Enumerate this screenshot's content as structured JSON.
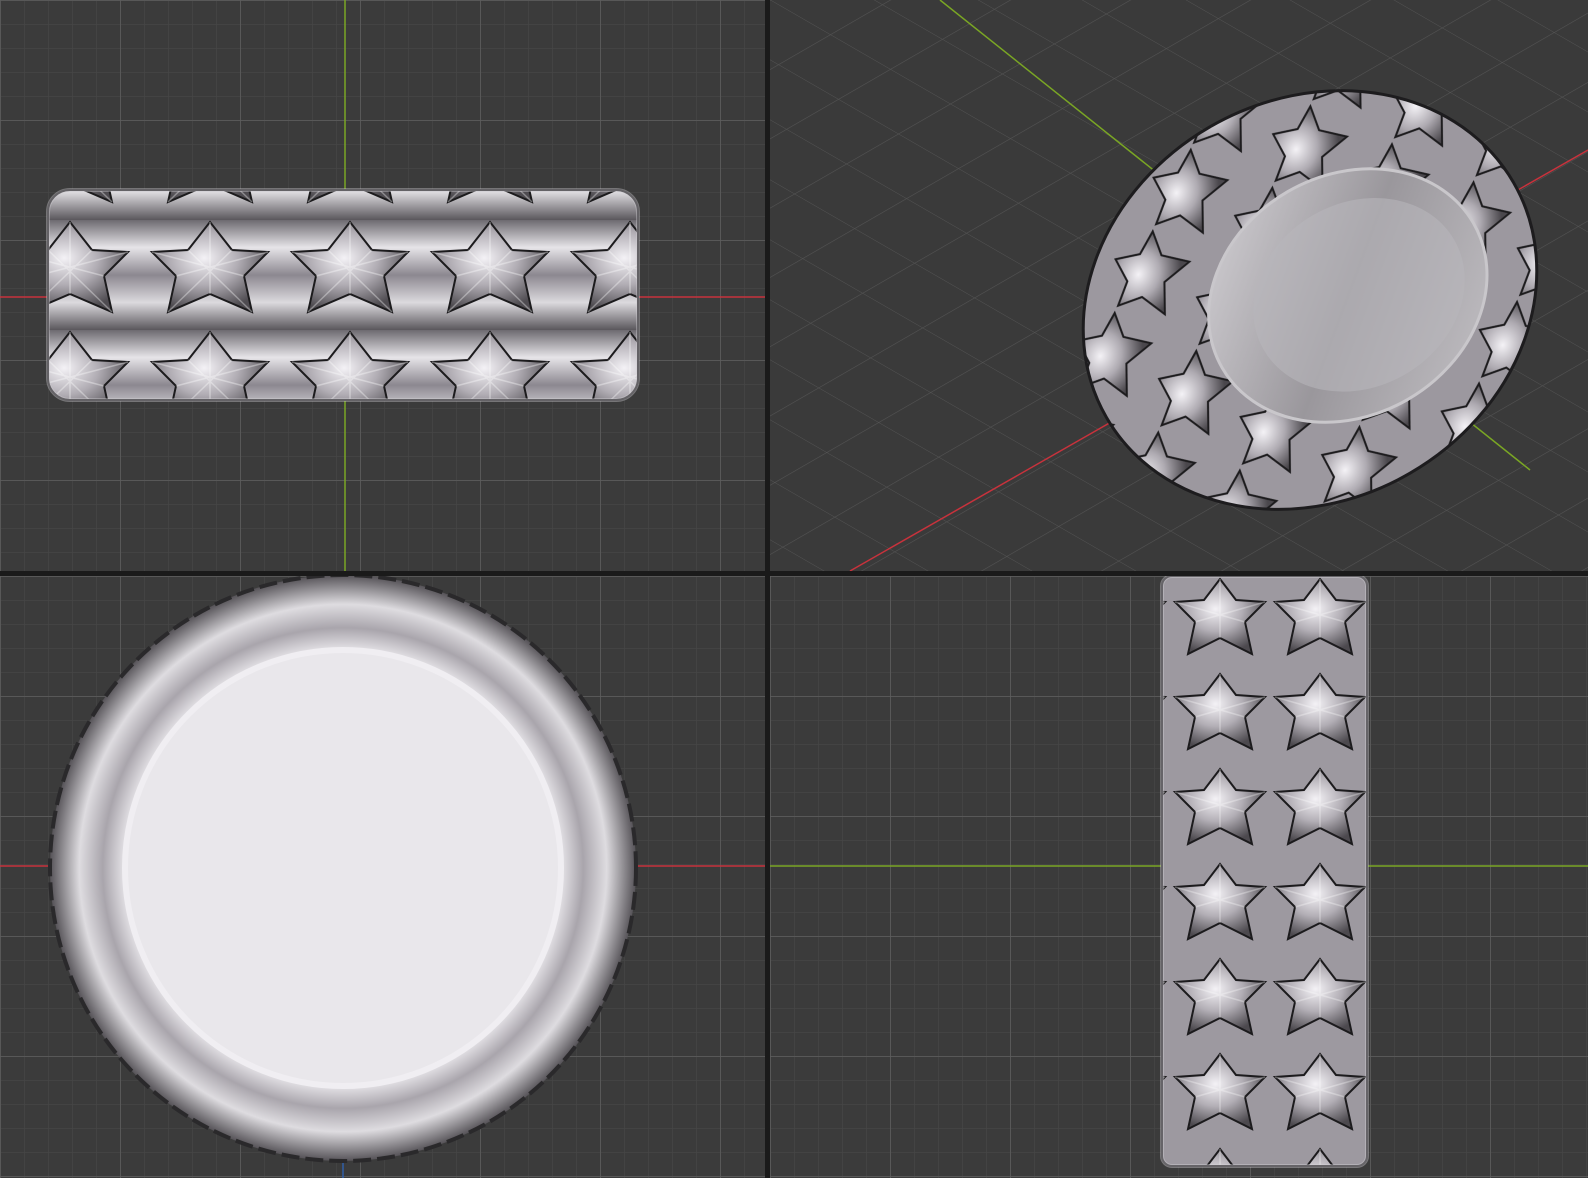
{
  "app": {},
  "viewports": [
    {
      "id": "front",
      "axes": [
        "x",
        "z"
      ]
    },
    {
      "id": "perspective",
      "axes": [
        "x",
        "y"
      ]
    },
    {
      "id": "top",
      "axes": [
        "x",
        "y"
      ]
    },
    {
      "id": "side",
      "axes": [
        "y",
        "z"
      ]
    }
  ],
  "colors": {
    "viewport_bg": "#3b3b3b",
    "grid_line": "#505050",
    "axis_x": "#c8323c",
    "axis_y": "#7aa624",
    "axis_z": "#2f5ea8",
    "metal_light": "#e8e6ea",
    "metal_mid": "#a8a4aa",
    "metal_dark": "#4a474c"
  },
  "object": {
    "name": "ring",
    "material": "polished-silver"
  }
}
